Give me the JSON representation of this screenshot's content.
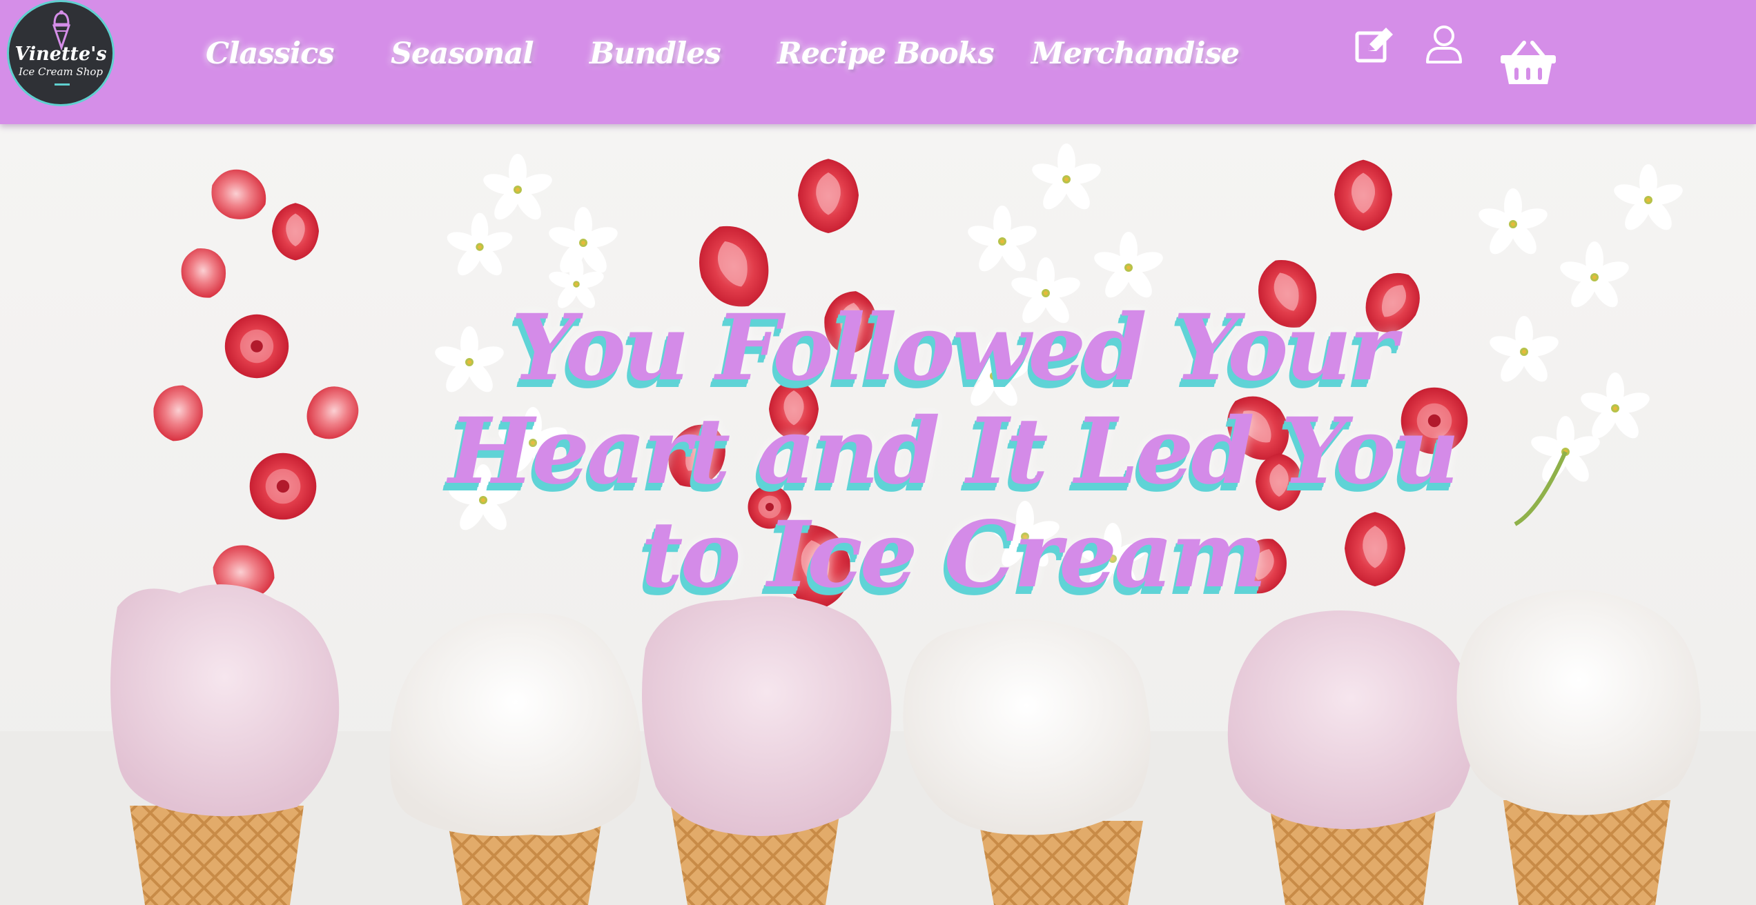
{
  "brand": {
    "name": "Vinette's",
    "subtitle": "Ice Cream Shop",
    "logo_icon": "ice-cream-cone-icon"
  },
  "nav": {
    "items": [
      {
        "label": "Classics"
      },
      {
        "label": "Seasonal"
      },
      {
        "label": "Bundles"
      },
      {
        "label": "Recipe Books"
      },
      {
        "label": "Merchandise"
      }
    ]
  },
  "header_actions": {
    "edit_icon": "edit-icon",
    "account_icon": "user-icon",
    "cart_icon": "basket-icon"
  },
  "hero": {
    "headline": "You Followed Your Heart and It Led You to Ice Cream",
    "image": "ice-cream-cones-strawberries-flowers"
  },
  "colors": {
    "header_bg": "#d58ee8",
    "accent_purple": "#d48be8",
    "accent_teal": "#5fd3d6",
    "logo_bg": "#2f3136"
  }
}
